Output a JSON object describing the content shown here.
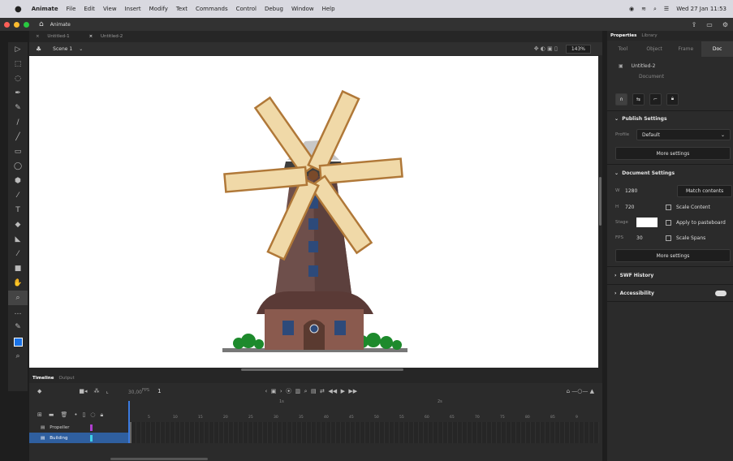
{
  "menubar": {
    "app": "Animate",
    "items": [
      "File",
      "Edit",
      "View",
      "Insert",
      "Modify",
      "Text",
      "Commands",
      "Control",
      "Debug",
      "Window",
      "Help"
    ],
    "datetime": "Wed 27 Jan 11:53"
  },
  "titlebar": {
    "app_name": "Animate"
  },
  "tabs": [
    "Untitled-1",
    "Untitled-2"
  ],
  "scene": {
    "label": "Scene 1",
    "zoom": "143%"
  },
  "properties": {
    "tabs": [
      "Properties",
      "Library"
    ],
    "subtabs": [
      "Tool",
      "Object",
      "Frame",
      "Doc"
    ],
    "doc_name": "Untitled-2",
    "doc_type": "Document",
    "publish": {
      "header": "Publish Settings",
      "profile_label": "Profile",
      "profile_value": "Default",
      "more": "More settings"
    },
    "document": {
      "header": "Document Settings",
      "w_label": "W",
      "w_value": "1280",
      "h_label": "H",
      "h_value": "720",
      "match": "Match contents",
      "scale_content": "Scale Content",
      "stage_label": "Stage",
      "apply_pasteboard": "Apply to pasteboard",
      "fps_label": "FPS",
      "fps_value": "30",
      "scale_spans": "Scale Spans",
      "more": "More settings"
    },
    "swf_history": "SWF History",
    "accessibility": "Accessibility"
  },
  "timeline": {
    "tabs": [
      "Timeline",
      "Output"
    ],
    "fps": "30,00",
    "fps_unit": "FPS",
    "frame": "1",
    "layers": [
      "Propeller",
      "Building"
    ],
    "markers_top": [
      "1s",
      "2s"
    ],
    "frame_numbers": [
      "5",
      "10",
      "15",
      "20",
      "25",
      "30",
      "35",
      "40",
      "45",
      "50",
      "55",
      "60",
      "65",
      "70",
      "75",
      "80",
      "85",
      "9"
    ]
  }
}
